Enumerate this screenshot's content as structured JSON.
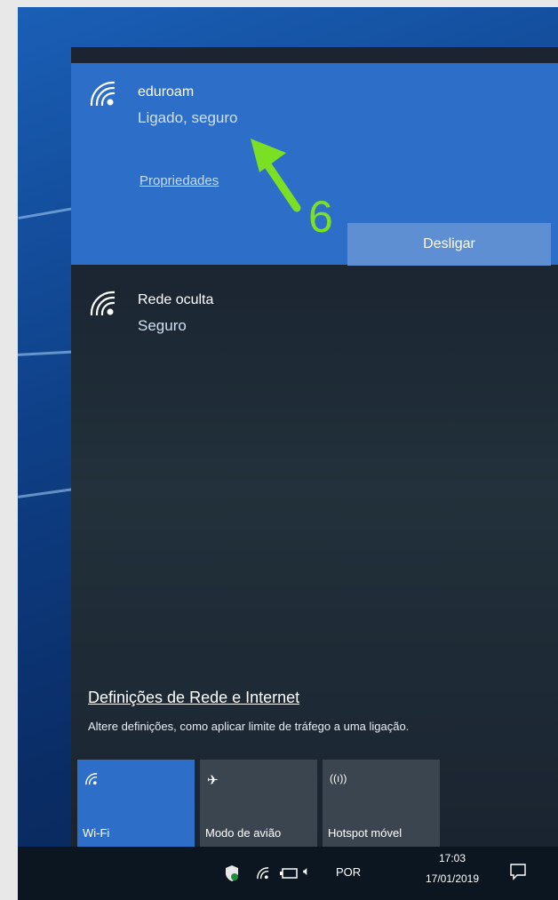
{
  "networks": [
    {
      "name": "eduroam",
      "status": "Ligado, seguro",
      "properties_label": "Propriedades",
      "disconnect_label": "Desligar"
    },
    {
      "name": "Rede oculta",
      "status": "Seguro"
    }
  ],
  "settings": {
    "link_label": "Definições de Rede e Internet",
    "description": "Altere definições, como aplicar limite de tráfego a uma ligação."
  },
  "quick_actions": [
    {
      "label": "Wi-Fi",
      "icon": "wifi-icon",
      "active": true
    },
    {
      "label": "Modo de avião",
      "icon": "airplane-icon",
      "active": false
    },
    {
      "label": "Hotspot móvel",
      "icon": "hotspot-icon",
      "active": false
    }
  ],
  "taskbar": {
    "language": "POR",
    "time": "17:03",
    "date": "17/01/2019"
  },
  "annotation": {
    "step_number": "6"
  },
  "colors": {
    "accent": "#2d6ec8",
    "button": "#5f8fd3",
    "annotation_green": "#7be024",
    "flyout_bg": "#1f2a35"
  }
}
